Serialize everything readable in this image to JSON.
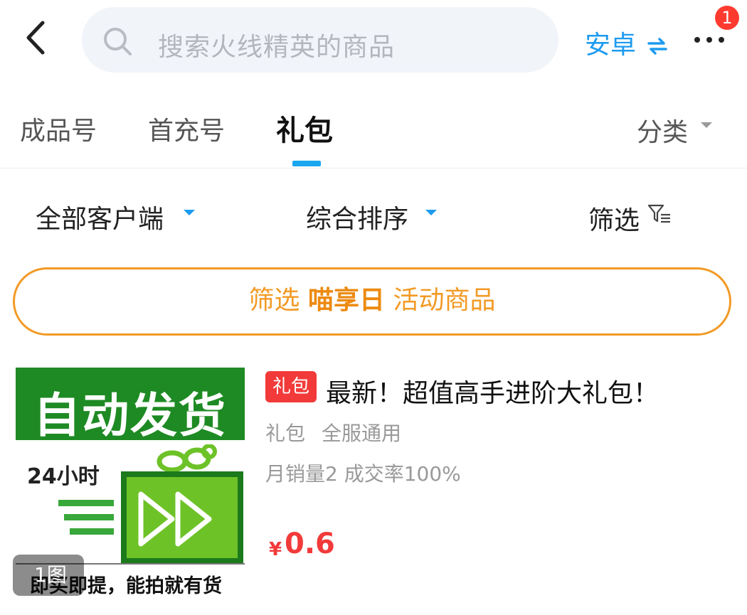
{
  "header": {
    "search_placeholder": "搜索火线精英的商品",
    "platform_label": "安卓",
    "platform_icon": "swap-icon",
    "notification_count": "1"
  },
  "tabs": [
    {
      "label": "成品号"
    },
    {
      "label": "首充号"
    },
    {
      "label": "礼包",
      "active": true
    }
  ],
  "classify_label": "分类",
  "filters": {
    "client_label": "全部客户端",
    "sort_label": "综合排序",
    "filter_label": "筛选"
  },
  "banner": {
    "prefix": "筛选",
    "highlight": "喵享日",
    "suffix": "活动商品"
  },
  "product": {
    "thumbnail": {
      "headline": "自动发货",
      "hours": "24小时",
      "footer": "即买即提，能拍就有货"
    },
    "image_count": "1图",
    "tag": "礼包",
    "title": "最新！超值高手进阶大礼包！",
    "category": "礼包",
    "server": "全服通用",
    "sales": "月销量2 成交率100%",
    "currency": "¥",
    "price": "0.6"
  },
  "colors": {
    "accent": "#1d9bf0",
    "banner_orange": "#f29a25",
    "price_red": "#f23a3a",
    "thumb_green": "#1e8a23"
  }
}
